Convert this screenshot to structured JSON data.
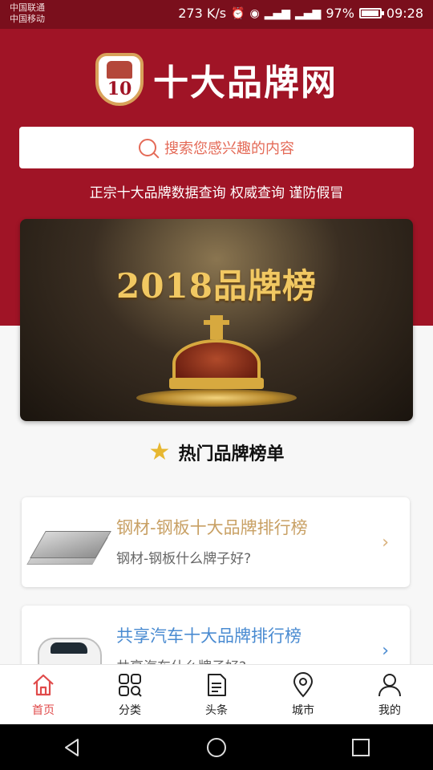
{
  "status_bar": {
    "carriers": [
      "中国联通",
      "中国移动"
    ],
    "net_speed": "273 K/s",
    "battery": "97%",
    "battery_level": 0.97,
    "time": "09:28"
  },
  "header": {
    "logo_text": "十大品牌网",
    "logo_badge_number": "10",
    "search_placeholder": "搜索您感兴趣的内容",
    "tagline": "正宗十大品牌数据查询 权威查询 谨防假冒"
  },
  "banner": {
    "title": "2018品牌榜"
  },
  "section": {
    "title": "热门品牌榜单"
  },
  "lists": [
    {
      "title": "钢材-钢板十大品牌排行榜",
      "subtitle": "钢材-钢板什么牌子好?"
    },
    {
      "title": "共享汽车十大品牌排行榜",
      "subtitle": "共享汽车什么牌子好?"
    }
  ],
  "bottom_nav": [
    {
      "label": "首页",
      "icon": "home-icon",
      "active": true
    },
    {
      "label": "分类",
      "icon": "grid-search-icon",
      "active": false
    },
    {
      "label": "头条",
      "icon": "document-icon",
      "active": false
    },
    {
      "label": "城市",
      "icon": "location-pin-icon",
      "active": false
    },
    {
      "label": "我的",
      "icon": "user-icon",
      "active": false
    }
  ],
  "colors": {
    "brand_red": "#a01426",
    "status_bar": "#7a0f1c",
    "accent_orange": "#e46a57",
    "active_nav": "#e04a4a",
    "gold": "#c8a064",
    "link_blue": "#4a8bd1"
  }
}
